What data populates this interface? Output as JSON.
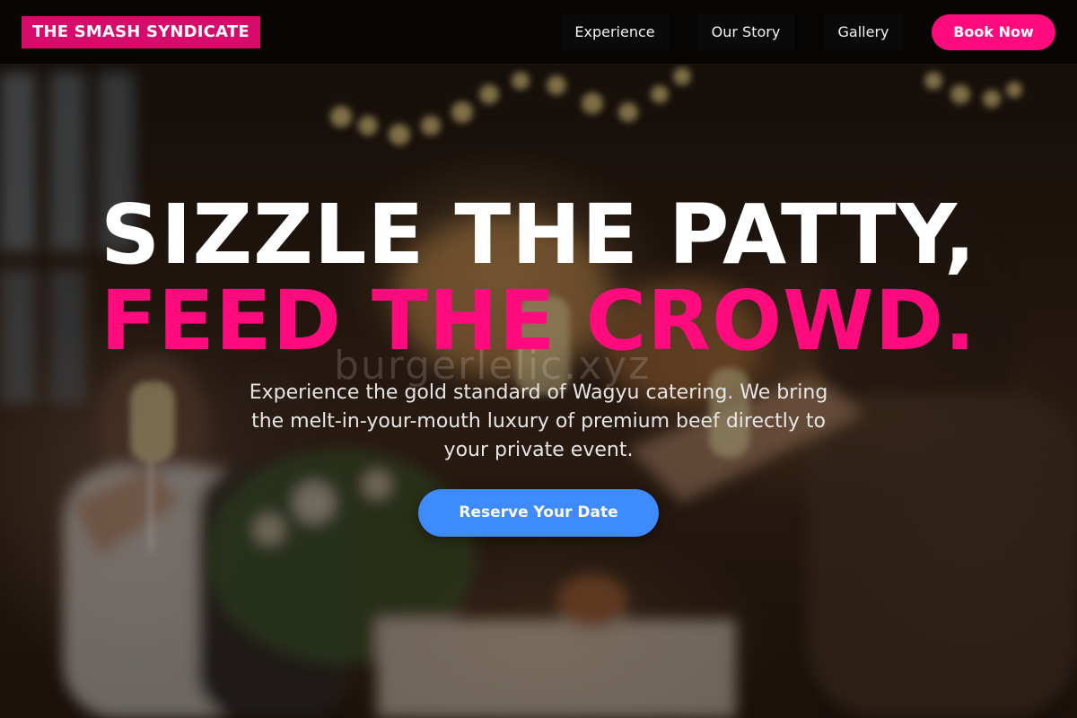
{
  "nav": {
    "brand": "THE SMASH SYNDICATE",
    "links": [
      {
        "label": "Experience"
      },
      {
        "label": "Our Story"
      },
      {
        "label": "Gallery"
      }
    ],
    "cta_label": "Book Now"
  },
  "hero": {
    "headline_line1": "SIZZLE THE PATTY,",
    "headline_line2": "FEED THE CROWD.",
    "watermark": "burgerlelic.xyz",
    "description": "Experience the gold standard of Wagyu catering. We bring the melt-in-your-mouth luxury of premium beef directly to your private event.",
    "cta_label": "Reserve Your Date",
    "background_image": "blurred-banquet-celebration-photo"
  },
  "colors": {
    "brand_pink": "#d60b6c",
    "accent_pink": "#ff0b7e",
    "cta_blue": "#3d8bff",
    "nav_background": "#060403",
    "text_white": "#ffffff"
  }
}
